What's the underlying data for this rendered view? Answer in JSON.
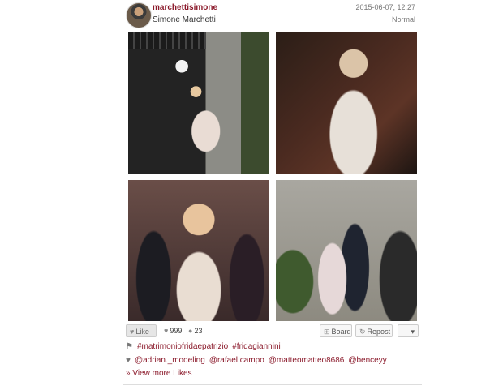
{
  "post": {
    "username": "marchettisimone",
    "full_name": "Simone Marchetti",
    "date": "2015-06-07, 12:27",
    "filter": "Normal"
  },
  "actions": {
    "like_label": "Like",
    "likes_count": "999",
    "comments_count": "23",
    "board_label": "Board",
    "repost_label": "Repost",
    "more_label": "··· ▾"
  },
  "tags": [
    "#matrimoniofridaepatrizio",
    "#fridagiannini"
  ],
  "likers": [
    "@adrian._modeling",
    "@rafael.campo",
    "@matteomatteo8686",
    "@benceyy"
  ],
  "view_more_likes": "» View more Likes",
  "icons": {
    "tag": "tag-icon",
    "heart": "heart-icon",
    "comment": "comment-icon",
    "board": "plus-icon",
    "repost": "repost-icon"
  }
}
